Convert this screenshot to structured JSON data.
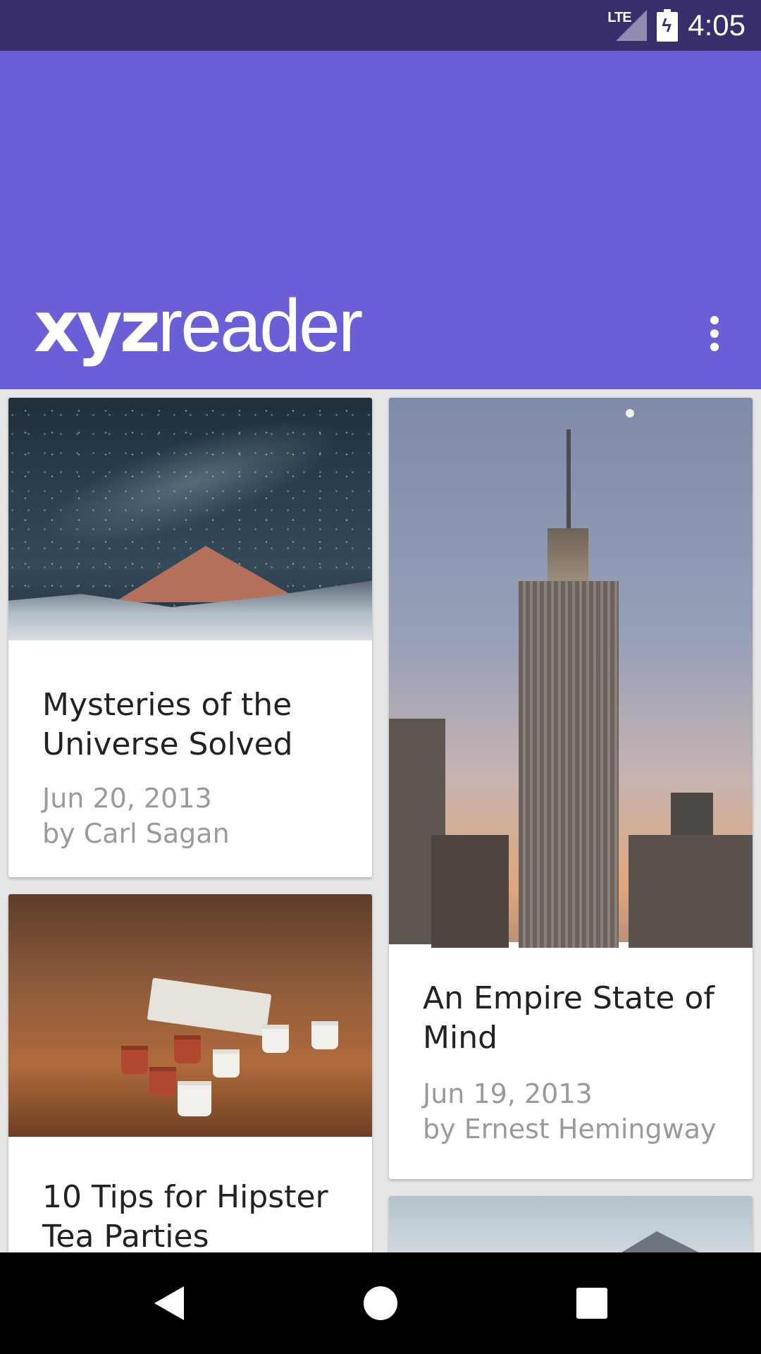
{
  "status_bar": {
    "network": "LTE",
    "time": "4:05",
    "icons": [
      "lte-signal-icon",
      "battery-charging-icon"
    ]
  },
  "app_bar": {
    "logo_bold": "xyz",
    "logo_light": "reader",
    "menu_icon": "overflow-menu-icon",
    "color": "#6b5fd8"
  },
  "articles": [
    {
      "title": "Mysteries of the Universe Solved",
      "date": "Jun 20, 2013",
      "byline": "by Carl Sagan",
      "image": "night-sky-mountain"
    },
    {
      "title": "An Empire State of Mind",
      "date": "Jun 19, 2013",
      "byline": "by Ernest Hemingway",
      "image": "empire-state-building"
    },
    {
      "title": "10 Tips for Hipster Tea Parties",
      "image": "tea-cups-table"
    },
    {
      "image": "snowy-mountain"
    }
  ],
  "nav_bar": {
    "icons": [
      "back-icon",
      "home-icon",
      "recents-icon"
    ]
  },
  "colors": {
    "status_bar": "#372f6b",
    "app_bar": "#6b5fd8",
    "background": "#e6e6e6",
    "meta_text": "#9a9a9a"
  }
}
